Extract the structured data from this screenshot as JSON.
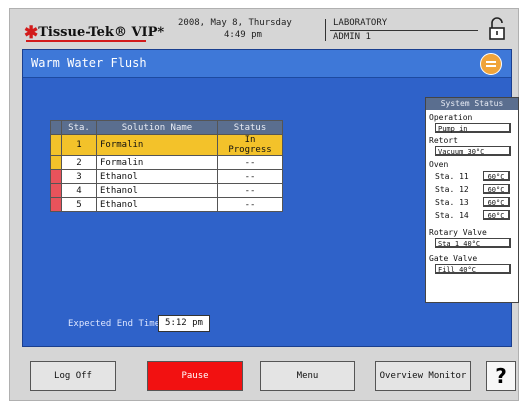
{
  "header": {
    "brand": "Tissue-Tek",
    "brand_suffix": "VIP",
    "date": "2008, May 8, Thursday",
    "time": "4:49 pm",
    "location": "LABORATORY",
    "user": "ADMIN 1",
    "lock_icon": "lock-icon"
  },
  "screen": {
    "title": "Warm Water Flush",
    "title_icon": "menu-icon"
  },
  "table": {
    "headers": [
      "Sta.",
      "Solution Name",
      "Status"
    ],
    "rows": [
      {
        "sta": "1",
        "name": "Formalin",
        "status": "In Progress",
        "marker": "#f3c22a"
      },
      {
        "sta": "2",
        "name": "Formalin",
        "status": "--",
        "marker": "#f3c22a"
      },
      {
        "sta": "3",
        "name": "Ethanol",
        "status": "--",
        "marker": "#e8535b"
      },
      {
        "sta": "4",
        "name": "Ethanol",
        "status": "--",
        "marker": "#e8535b"
      },
      {
        "sta": "5",
        "name": "Ethanol",
        "status": "--",
        "marker": "#e8535b"
      }
    ]
  },
  "system_status": {
    "title": "System Status",
    "operation_label": "Operation",
    "operation_value": "Pump in",
    "retort_label": "Retort",
    "retort_value": "Vacuum  30°C",
    "oven_label": "Oven",
    "oven": [
      {
        "station": "Sta. 11",
        "temp": "60°C"
      },
      {
        "station": "Sta. 12",
        "temp": "60°C"
      },
      {
        "station": "Sta. 13",
        "temp": "60°C"
      },
      {
        "station": "Sta. 14",
        "temp": "60°C"
      }
    ],
    "rotary_label": "Rotary Valve",
    "rotary_value": "Sta 1  40°C",
    "gate_label": "Gate Valve",
    "gate_value": "Fill  40°C"
  },
  "expected_end": {
    "label": "Expected End Time",
    "value": "5:12 pm"
  },
  "buttons": {
    "log_off": "Log Off",
    "pause": "Pause",
    "menu": "Menu",
    "overview": "Overview Monitor",
    "help": "?"
  },
  "colors": {
    "panel": "#2f62c9",
    "active_row": "#f3c22a",
    "pause": "#f21111",
    "brand_red": "#d21b1b"
  }
}
